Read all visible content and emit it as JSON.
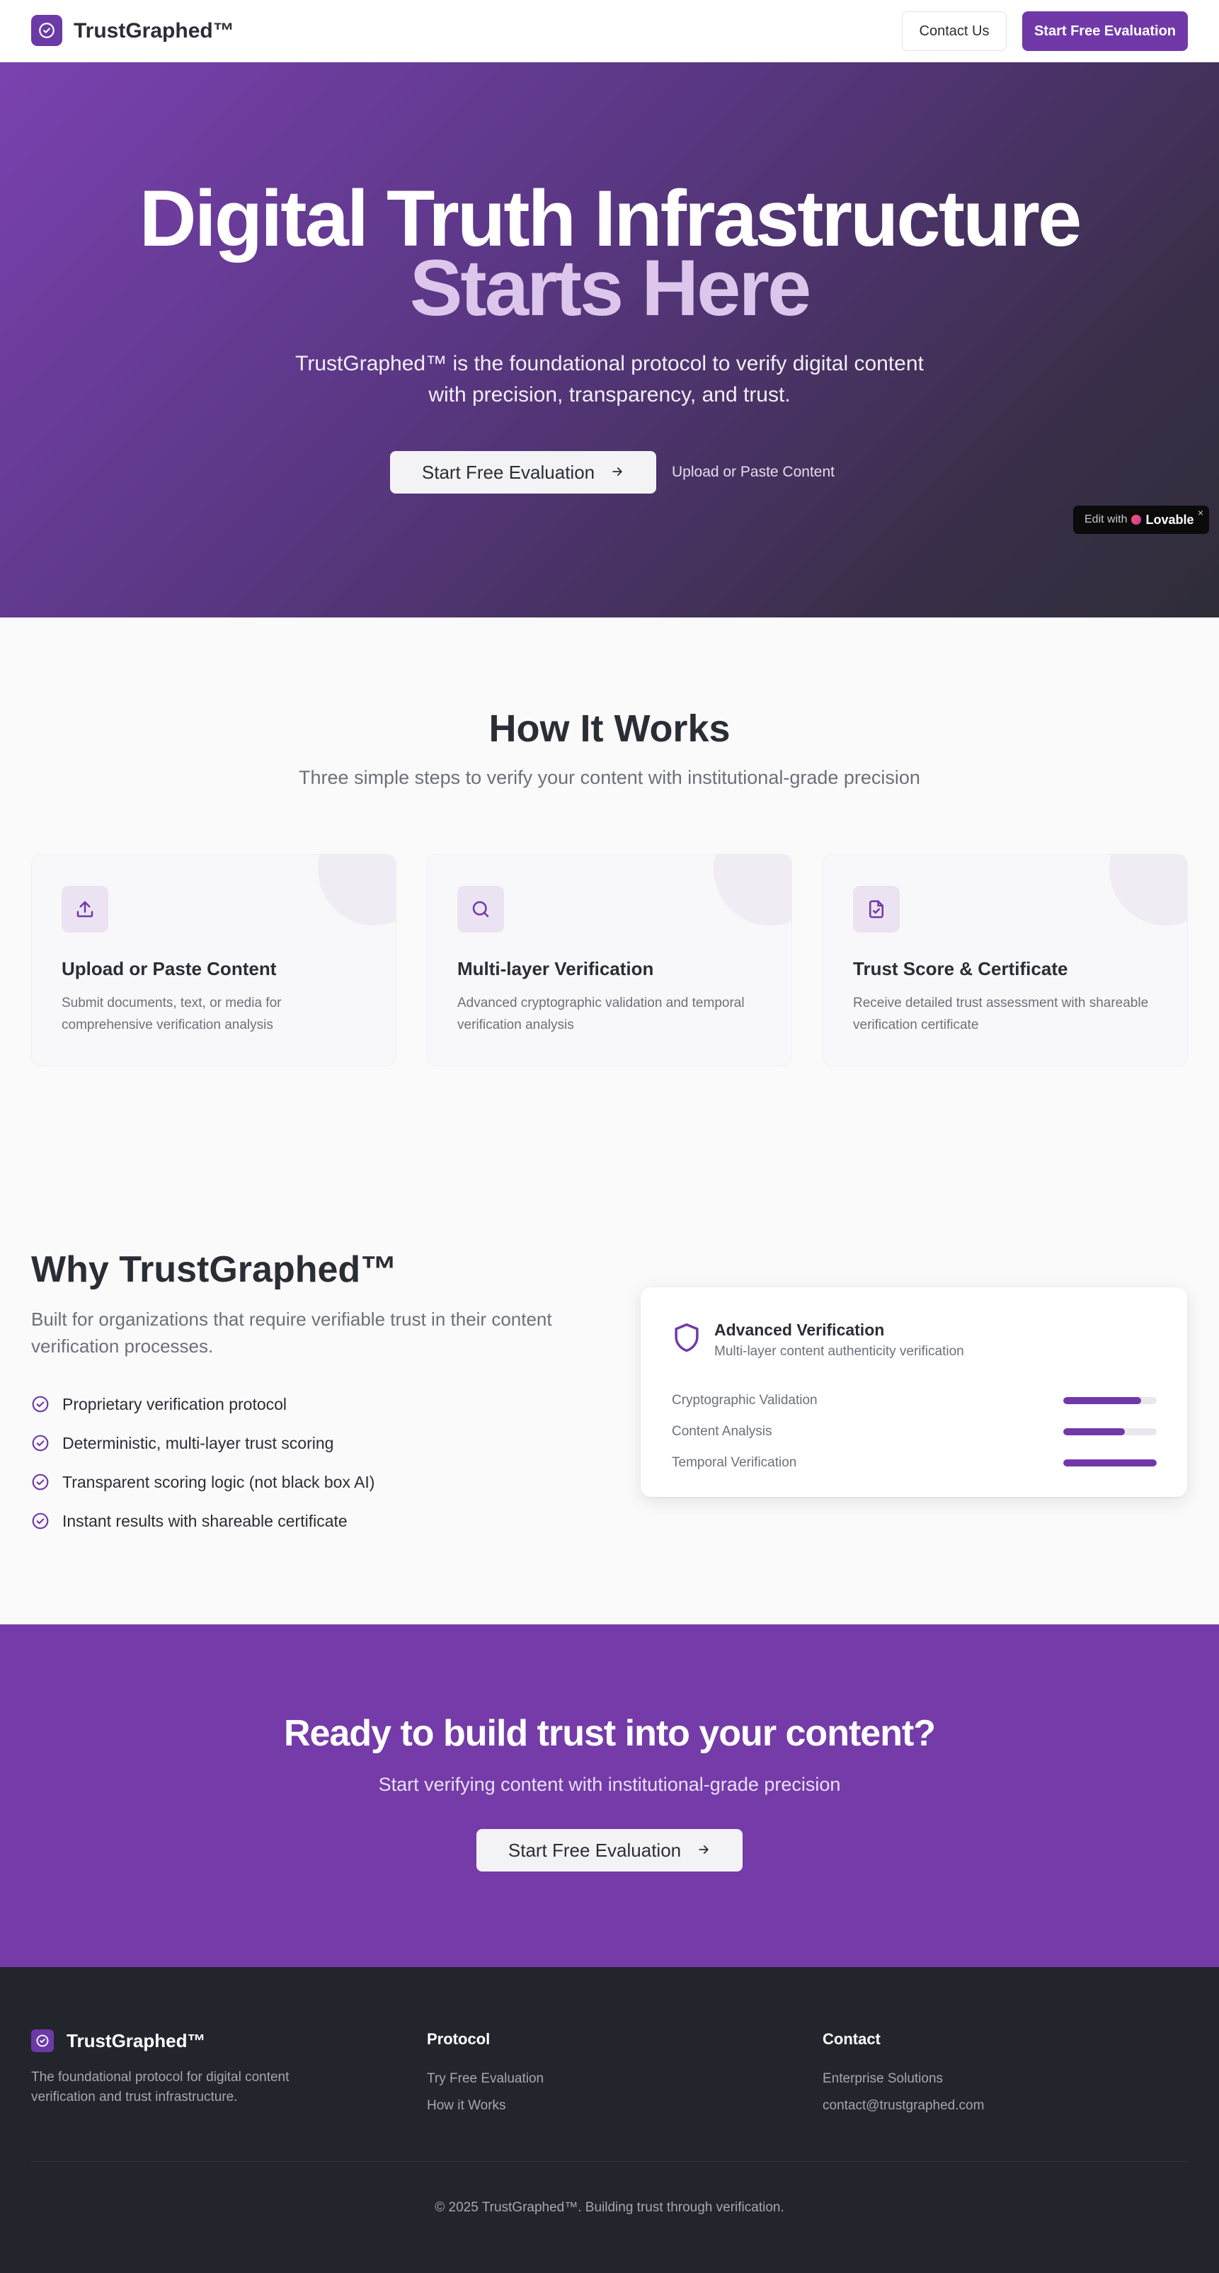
{
  "colors": {
    "brand": "#7139a8",
    "hero_gradient_start": "#7a42b0",
    "hero_gradient_end": "#2f2d38",
    "accent_light": "#dcc6ec",
    "footer_bg": "#23252d"
  },
  "nav": {
    "brand": "TrustGraphed™",
    "logo_icon": "check-circle-icon",
    "contact_label": "Contact Us",
    "start_label": "Start Free Evaluation"
  },
  "hero": {
    "title_line1": "Digital Truth Infrastructure",
    "title_line2": "Starts Here",
    "subtitle": "TrustGraphed™ is the foundational protocol to verify digital content with precision, transparency, and trust.",
    "cta_label": "Start Free Evaluation",
    "cta_icon": "arrow-right-icon",
    "secondary_link": "Upload or Paste Content"
  },
  "lovable_badge": {
    "edit_text": "Edit with",
    "brand": "Lovable",
    "close": "×"
  },
  "how": {
    "title": "How It Works",
    "subtitle": "Three simple steps to verify your content with institutional-grade precision",
    "steps": [
      {
        "icon": "upload-icon",
        "title": "Upload or Paste Content",
        "desc": "Submit documents, text, or media for comprehensive verification analysis"
      },
      {
        "icon": "search-icon",
        "title": "Multi-layer Verification",
        "desc": "Advanced cryptographic validation and temporal verification analysis"
      },
      {
        "icon": "file-check-icon",
        "title": "Trust Score & Certificate",
        "desc": "Receive detailed trust assessment with shareable verification certificate"
      }
    ]
  },
  "why": {
    "title": "Why TrustGraphed™",
    "subtitle": "Built for organizations that require verifiable trust in their content verification processes.",
    "features": [
      "Proprietary verification protocol",
      "Deterministic, multi-layer trust scoring",
      "Transparent scoring logic (not black box AI)",
      "Instant results with shareable certificate"
    ],
    "card": {
      "icon": "shield-icon",
      "title": "Advanced Verification",
      "subtitle": "Multi-layer content authenticity verification",
      "metrics": [
        {
          "label": "Cryptographic Validation",
          "value": 0.83
        },
        {
          "label": "Content Analysis",
          "value": 0.66
        },
        {
          "label": "Temporal Verification",
          "value": 1.0
        }
      ]
    }
  },
  "cta": {
    "title": "Ready to build trust into your content?",
    "subtitle": "Start verifying content with institutional-grade precision",
    "button_label": "Start Free Evaluation"
  },
  "footer": {
    "brand": "TrustGraphed™",
    "description": "The foundational protocol for digital content verification and trust infrastructure.",
    "protocol_heading": "Protocol",
    "protocol_links": [
      "Try Free Evaluation",
      "How it Works"
    ],
    "contact_heading": "Contact",
    "contact_links": [
      "Enterprise Solutions",
      "contact@trustgraphed.com"
    ],
    "copyright": "© 2025 TrustGraphed™. Building trust through verification."
  }
}
